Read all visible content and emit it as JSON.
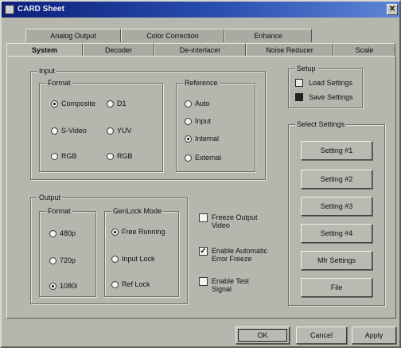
{
  "window": {
    "title": "CARD Sheet",
    "close_glyph": "✕"
  },
  "tabs_back": [
    "Analog Output",
    "Color Correction",
    "Enhance"
  ],
  "tabs_front": [
    "System",
    "Decoder",
    "De-interlacer",
    "Noise Reducer",
    "Scale"
  ],
  "input": {
    "legend": "Input",
    "format": {
      "legend": "Format",
      "options": [
        "Composite",
        "D1",
        "S-Video",
        "YUV",
        "RGB"
      ],
      "rgb_prefix": "RGB",
      "selected": "Composite"
    },
    "reference": {
      "legend": "Reference",
      "options": [
        "Auto",
        "Input",
        "Internal",
        "External"
      ],
      "selected": "Internal"
    }
  },
  "output": {
    "legend": "Output",
    "format": {
      "legend": "Format",
      "options": [
        "480p",
        "720p",
        "1080i"
      ],
      "selected": "1080i"
    },
    "genlock": {
      "legend": "GenLock Mode",
      "options": [
        "Free Running",
        "Input Lock",
        "Ref Lock"
      ],
      "selected": "Free Running"
    }
  },
  "checks": {
    "freeze_line1": "Freeze Output",
    "freeze_line2": "Video",
    "freeze_checked": false,
    "auto_line1": "Enable Automatic",
    "auto_line2": "Error Freeze",
    "auto_checked": true,
    "test_line1": "Enable Test",
    "test_line2": "Signal",
    "test_checked": false,
    "check_glyph": "✓"
  },
  "setup": {
    "legend": "Setup",
    "load": "Load Settings",
    "save": "Save Settings",
    "selected": "Save Settings"
  },
  "select_settings": {
    "legend": "Select Settings",
    "buttons": [
      "Setting #1",
      "Setting #2",
      "Setting #3",
      "Setting #4",
      "Mfr Settings",
      "File"
    ]
  },
  "footer": {
    "ok": "OK",
    "cancel": "Cancel",
    "apply": "Apply"
  }
}
